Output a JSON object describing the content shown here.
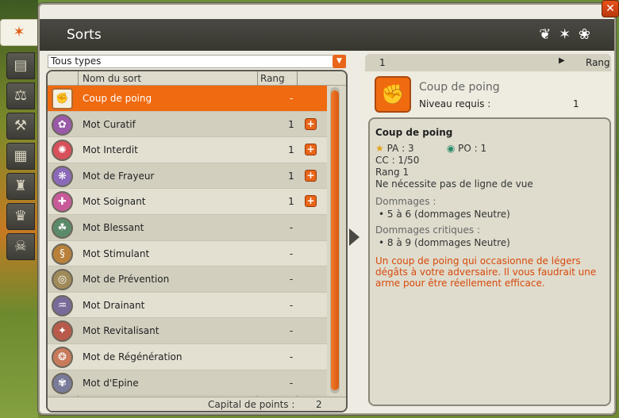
{
  "window": {
    "title": "Sorts",
    "close_glyph": "✕",
    "ornament": "❦ ✶ ❀"
  },
  "side_tabs": [
    {
      "icon": "spell-star-icon",
      "glyph": "✶",
      "active": true
    },
    {
      "icon": "book-icon",
      "glyph": "▤",
      "active": false
    },
    {
      "icon": "scales-icon",
      "glyph": "⚖",
      "active": false
    },
    {
      "icon": "crossed-tools-icon",
      "glyph": "⚒",
      "active": false
    },
    {
      "icon": "calendar-icon",
      "glyph": "▦",
      "active": false
    },
    {
      "icon": "trophy-icon",
      "glyph": "♜",
      "active": false
    },
    {
      "icon": "crown-icon",
      "glyph": "♛",
      "active": false
    },
    {
      "icon": "mask-icon",
      "glyph": "☠",
      "active": false
    }
  ],
  "filter": {
    "value": "Tous types",
    "arrow": "▼"
  },
  "list": {
    "header_name": "Nom du sort",
    "header_rank": "Rang",
    "capital_label": "Capital de points :",
    "capital_value": "2",
    "spells": [
      {
        "name": "Coup de poing",
        "rank": "-",
        "upgradable": false,
        "selected": true,
        "glyph": "✊",
        "color": "#f3efe3"
      },
      {
        "name": "Mot Curatif",
        "rank": "1",
        "upgradable": true,
        "selected": false,
        "glyph": "✿",
        "color": "#9a5aa8"
      },
      {
        "name": "Mot Interdit",
        "rank": "1",
        "upgradable": true,
        "selected": false,
        "glyph": "✺",
        "color": "#d8505a"
      },
      {
        "name": "Mot de Frayeur",
        "rank": "1",
        "upgradable": true,
        "selected": false,
        "glyph": "❋",
        "color": "#8a6ab8"
      },
      {
        "name": "Mot Soignant",
        "rank": "1",
        "upgradable": true,
        "selected": false,
        "glyph": "✚",
        "color": "#c85a9a"
      },
      {
        "name": "Mot Blessant",
        "rank": "-",
        "upgradable": false,
        "selected": false,
        "glyph": "☘",
        "color": "#5a8a6a"
      },
      {
        "name": "Mot Stimulant",
        "rank": "-",
        "upgradable": false,
        "selected": false,
        "glyph": "§",
        "color": "#b8803a"
      },
      {
        "name": "Mot de Prévention",
        "rank": "-",
        "upgradable": false,
        "selected": false,
        "glyph": "◎",
        "color": "#a08a5a"
      },
      {
        "name": "Mot Drainant",
        "rank": "-",
        "upgradable": false,
        "selected": false,
        "glyph": "♒",
        "color": "#7a6a9a"
      },
      {
        "name": "Mot Revitalisant",
        "rank": "-",
        "upgradable": false,
        "selected": false,
        "glyph": "✦",
        "color": "#b85a4a"
      },
      {
        "name": "Mot de Régénération",
        "rank": "-",
        "upgradable": false,
        "selected": false,
        "glyph": "❂",
        "color": "#c87a5a"
      },
      {
        "name": "Mot d'Epine",
        "rank": "-",
        "upgradable": false,
        "selected": false,
        "glyph": "✾",
        "color": "#7a7a9a"
      }
    ]
  },
  "detail": {
    "tab_rank": "1",
    "tab_arrow": "▶",
    "tab_label": "Rang",
    "icon_glyph": "✊",
    "spell_name": "Coup de poing",
    "level_label": "Niveau requis :",
    "level_value": "1",
    "box": {
      "title": "Coup de poing",
      "pa": "PA : 3",
      "po": "PO : 1",
      "cc": "CC : 1/50",
      "rank": "Rang 1",
      "los": "Ne nécessite pas de ligne de vue",
      "damage_head": "Dommages :",
      "damage": "• 5 à 6 (dommages Neutre)",
      "crit_head": "Dommages critiques :",
      "crit": "• 8 à 9 (dommages Neutre)",
      "description": "Un coup de poing qui occasionne de légers dégâts à votre adversaire. Il vous faudrait une arme pour être réellement efficace."
    }
  }
}
